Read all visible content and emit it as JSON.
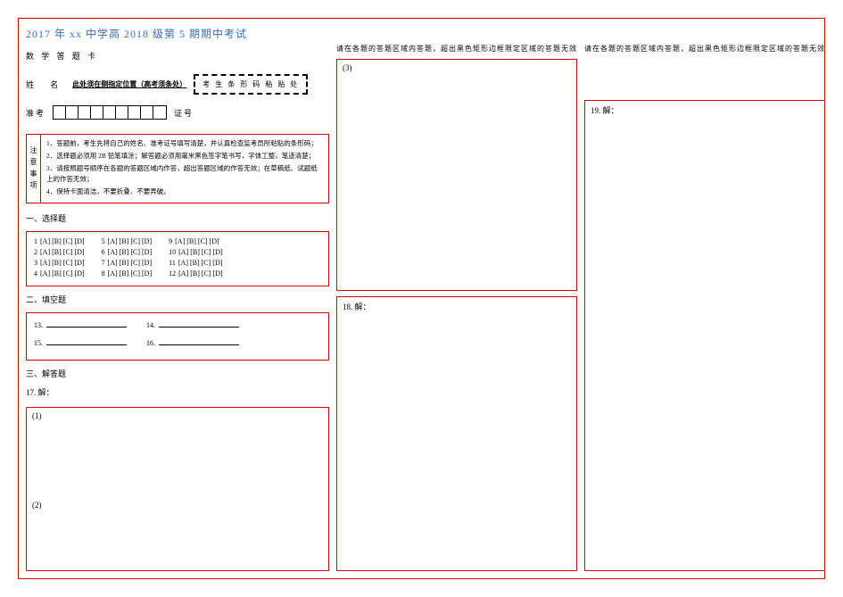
{
  "header": {
    "title": "2017 年 xx 中学高 2018 级第 5 期期中考试",
    "card_label": "数 学 答 题 卡"
  },
  "student": {
    "name_label": "姓  名",
    "name_slot_text": "此处须在侧指定位置（高考须条处）",
    "barcode_label": "考 生 条 形 码 粘 贴 处",
    "seat_label": "准考",
    "cert_label": "证号"
  },
  "notice": {
    "side_label": "注意事项",
    "items": [
      "1．答题前，考生先将自己的姓名、准考证号填写清楚，并认真检查监考员所粘贴的条形码；",
      "2．选择题必须用 2B 铅笔填涂；解答题必须用毫米黑色签字笔书写，字体工整，笔迹清楚；",
      "3．请按照题号顺序在各题的答题区域内作答，超出答题区域的作答无效；在草稿纸、试题纸上的作答无效；",
      "4．保持卡面清洁，不要折叠、不要弄破。"
    ]
  },
  "sections": {
    "mc_label": "一、选择题",
    "fill_label": "二、填空题",
    "solve_label": "三、解答题"
  },
  "mc": {
    "options": [
      "A",
      "B",
      "C",
      "D"
    ],
    "col1": [
      1,
      2,
      3,
      4
    ],
    "col2": [
      5,
      6,
      7,
      8
    ],
    "col3": [
      9,
      10,
      11,
      12
    ]
  },
  "fill": {
    "q13": "13.",
    "q14": "14.",
    "q15": "15.",
    "q16": "16."
  },
  "solve": {
    "q17": "17. 解：",
    "q17_1": "(1)",
    "q17_2": "(2)",
    "q17_3": "(3)",
    "q18": "18. 解：",
    "q19": "19. 解："
  },
  "column_reminder": "请在各题的答题区域内答题，超出黑色矩形边框限定区域的答题无效"
}
